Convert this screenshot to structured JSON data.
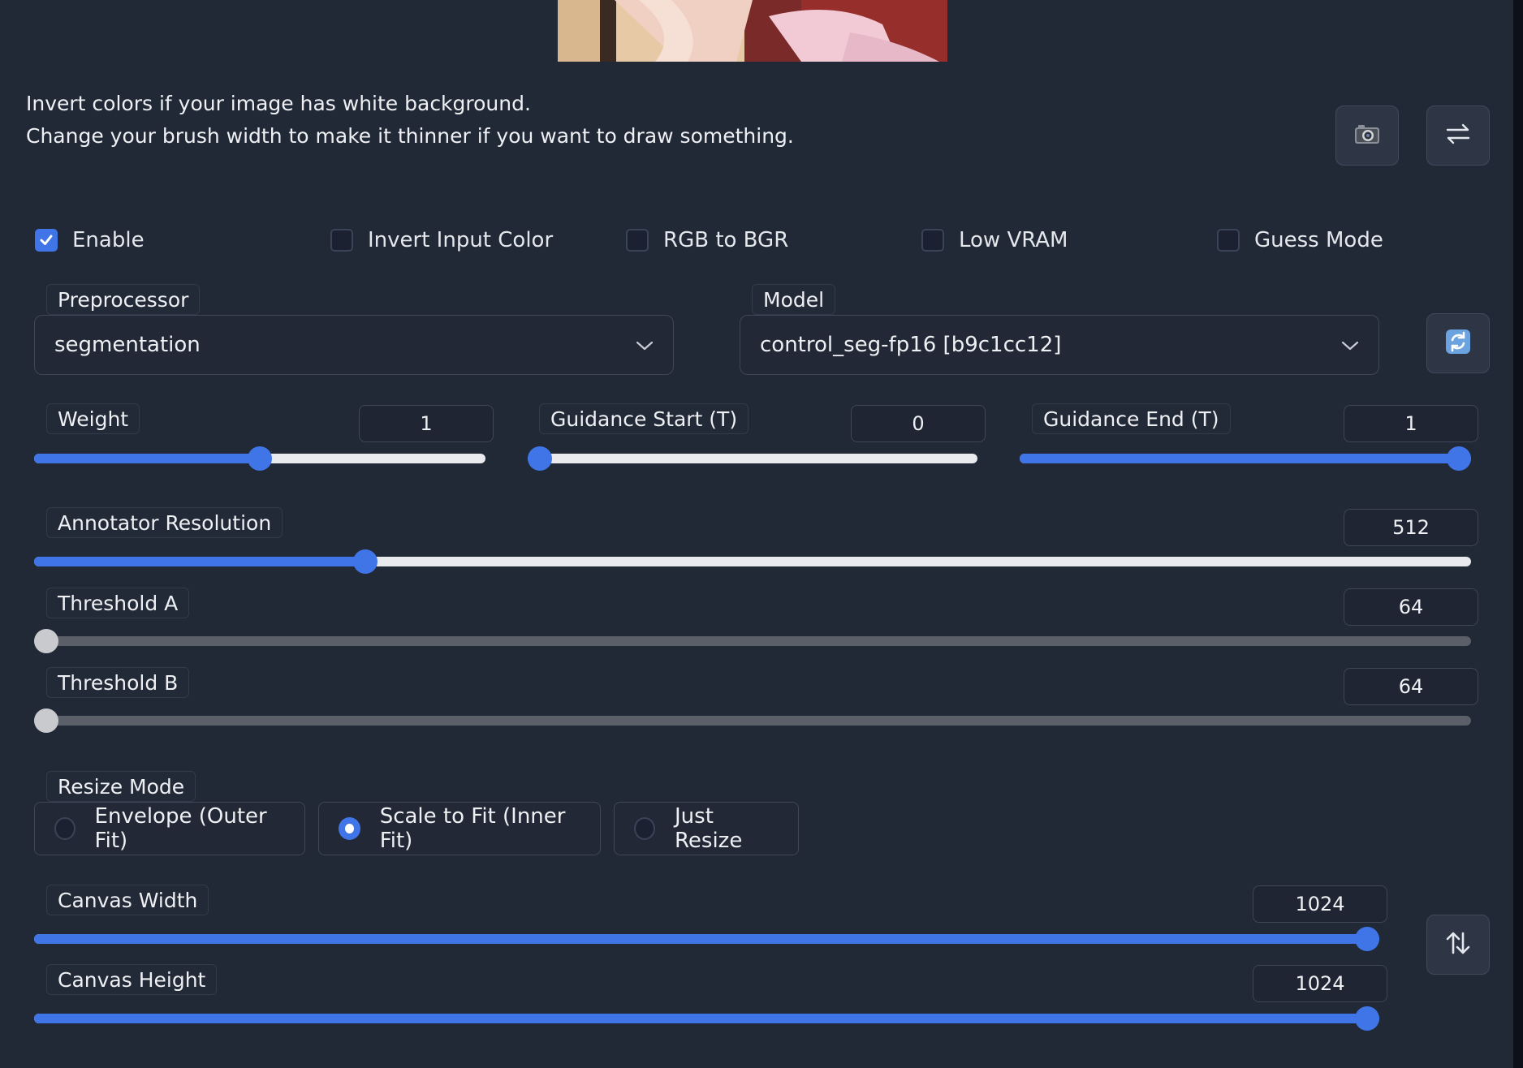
{
  "info": {
    "line1": "Invert colors if your image has white background.",
    "line2": "Change your brush width to make it thinner if you want to draw something."
  },
  "icons": {
    "camera": "camera-icon",
    "swap": "swap-arrows-icon",
    "refresh": "refresh-icon",
    "swap_dims": "swap-vertical-icon"
  },
  "checkboxes": [
    {
      "label": "Enable",
      "checked": true
    },
    {
      "label": "Invert Input Color",
      "checked": false
    },
    {
      "label": "RGB to BGR",
      "checked": false
    },
    {
      "label": "Low VRAM",
      "checked": false
    },
    {
      "label": "Guess Mode",
      "checked": false
    }
  ],
  "preprocessor": {
    "label": "Preprocessor",
    "value": "segmentation"
  },
  "model": {
    "label": "Model",
    "value": "control_seg-fp16 [b9c1cc12]"
  },
  "sliders": {
    "weight": {
      "label": "Weight",
      "value": "1",
      "fraction": 0.5
    },
    "guidance_start": {
      "label": "Guidance Start (T)",
      "value": "0",
      "fraction": 0.0
    },
    "guidance_end": {
      "label": "Guidance End (T)",
      "value": "1",
      "fraction": 1.0
    },
    "annotator_resolution": {
      "label": "Annotator Resolution",
      "value": "512",
      "fraction": 0.23
    },
    "threshold_a": {
      "label": "Threshold A",
      "value": "64",
      "fraction": 0.0
    },
    "threshold_b": {
      "label": "Threshold B",
      "value": "64",
      "fraction": 0.0
    },
    "canvas_width": {
      "label": "Canvas Width",
      "value": "1024",
      "fraction": 1.0
    },
    "canvas_height": {
      "label": "Canvas Height",
      "value": "1024",
      "fraction": 1.0
    }
  },
  "resize_mode": {
    "label": "Resize Mode",
    "options": [
      "Envelope (Outer Fit)",
      "Scale to Fit (Inner Fit)",
      "Just Resize"
    ],
    "selected": "Scale to Fit (Inner Fit)"
  },
  "colors": {
    "accent": "#3f75e6",
    "background": "#212836"
  }
}
